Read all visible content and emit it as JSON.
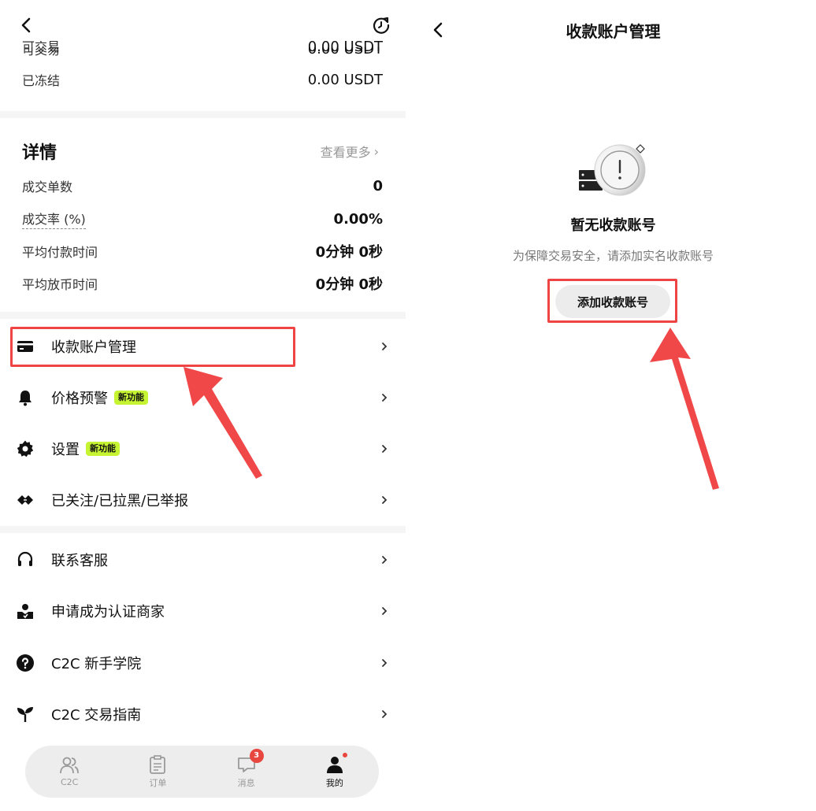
{
  "left": {
    "top_rows": [
      {
        "label": "可交易",
        "value": "0.00 USDT"
      },
      {
        "label": "已冻结",
        "value": "0.00 USDT"
      }
    ],
    "details": {
      "title": "详情",
      "view_more": "查看更多",
      "rows": [
        {
          "label": "成交单数",
          "value": "0"
        },
        {
          "label": "成交率 (%)",
          "value": "0.00%"
        },
        {
          "label": "平均付款时间",
          "value": "0分钟 0秒"
        },
        {
          "label": "平均放币时间",
          "value": "0分钟 0秒"
        }
      ]
    },
    "menu_group1": [
      {
        "label": "收款账户管理",
        "icon": "card-icon"
      },
      {
        "label": "价格预警",
        "icon": "bell-icon",
        "badge": "新功能"
      },
      {
        "label": "设置",
        "icon": "gear-icon",
        "badge": "新功能"
      },
      {
        "label": "已关注/已拉黑/已举报",
        "icon": "handshake-icon"
      }
    ],
    "menu_group2": [
      {
        "label": "联系客服",
        "icon": "headset-icon"
      },
      {
        "label": "申请成为认证商家",
        "icon": "merchant-icon"
      },
      {
        "label": "C2C 新手学院",
        "icon": "question-icon"
      },
      {
        "label": "C2C 交易指南",
        "icon": "sprout-icon"
      }
    ],
    "tabbar": [
      {
        "label": "C2C",
        "icon": "users-icon"
      },
      {
        "label": "订单",
        "icon": "clipboard-icon"
      },
      {
        "label": "消息",
        "icon": "chat-icon",
        "badge": "3"
      },
      {
        "label": "我的",
        "icon": "person-icon",
        "active": true
      }
    ]
  },
  "right": {
    "title": "收款账户管理",
    "empty_title": "暂无收款账号",
    "empty_subtitle": "为保障交易安全，请添加实名收款账号",
    "add_button": "添加收款账号"
  },
  "colors": {
    "highlight": "#ef4444",
    "badge_new": "#c6f432",
    "tab_badge": "#e8473f"
  }
}
